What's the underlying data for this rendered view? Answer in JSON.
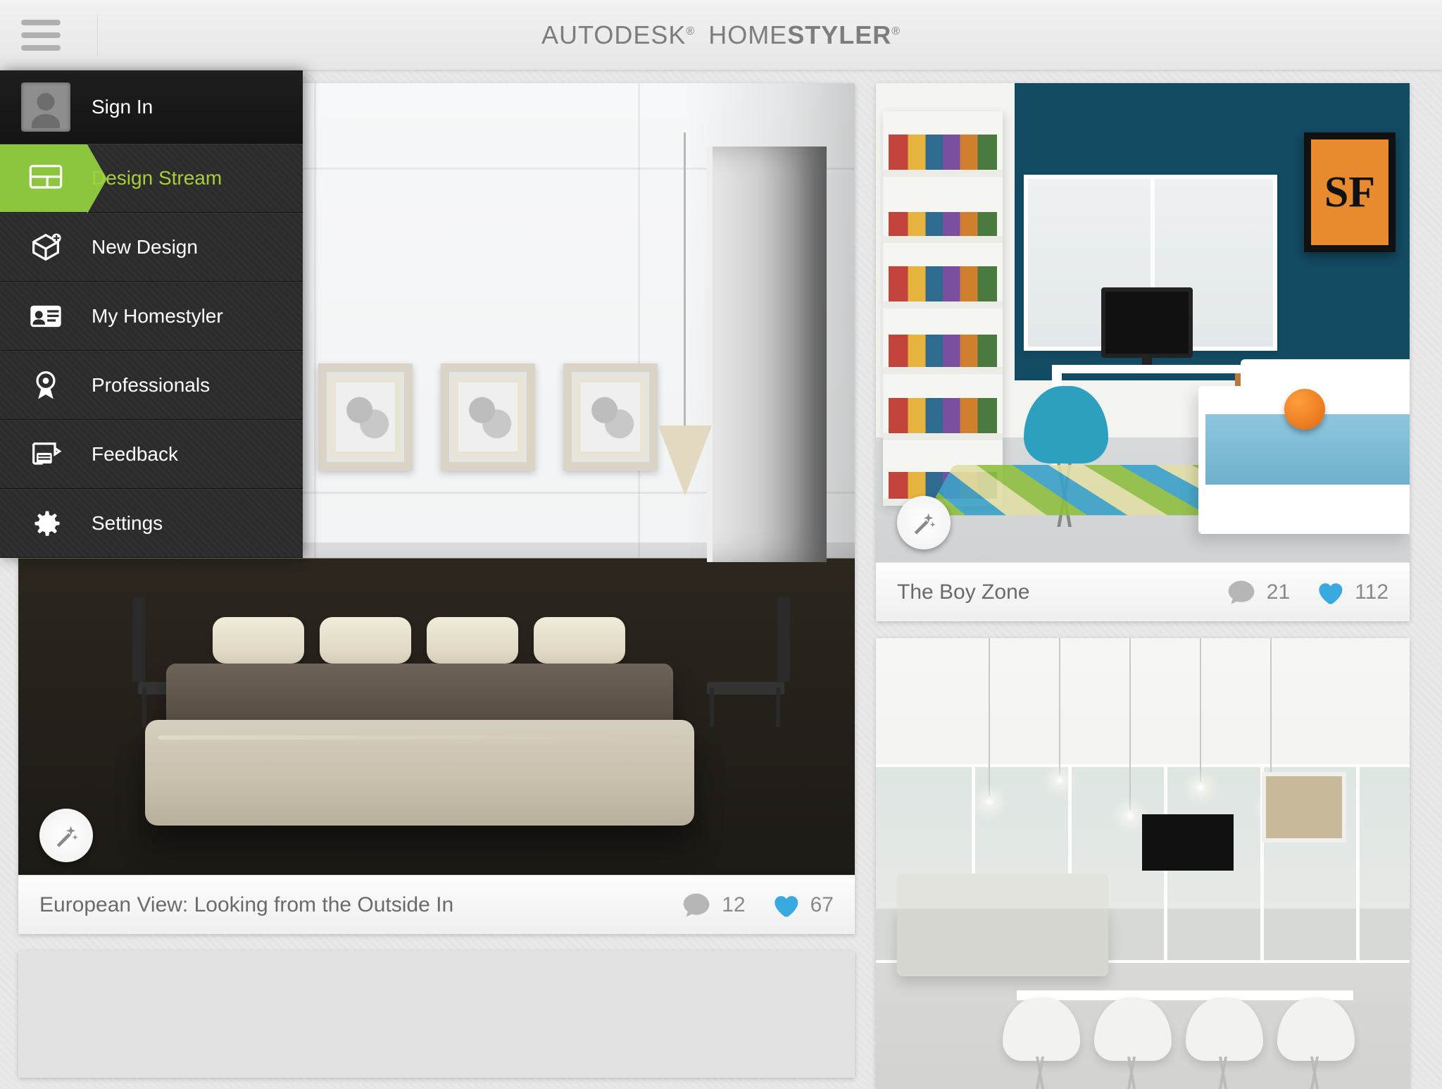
{
  "brand": {
    "company": "AUTODESK",
    "product_light": "HOME",
    "product_bold": "STYLER"
  },
  "drawer": {
    "signin_label": "Sign In",
    "items": [
      {
        "label": "Design Stream"
      },
      {
        "label": "New Design"
      },
      {
        "label": "My Homestyler"
      },
      {
        "label": "Professionals"
      },
      {
        "label": "Feedback"
      },
      {
        "label": "Settings"
      }
    ]
  },
  "cards": {
    "euro": {
      "title": "European View: Looking from the Outside In",
      "comments": "12",
      "likes": "67"
    },
    "boyzone": {
      "title": "The Boy Zone",
      "comments": "21",
      "likes": "112",
      "poster_text": "SF"
    }
  },
  "colors": {
    "accent_green": "#8cc63f",
    "like_blue": "#39a9e0",
    "boy_wall": "#134b63"
  }
}
